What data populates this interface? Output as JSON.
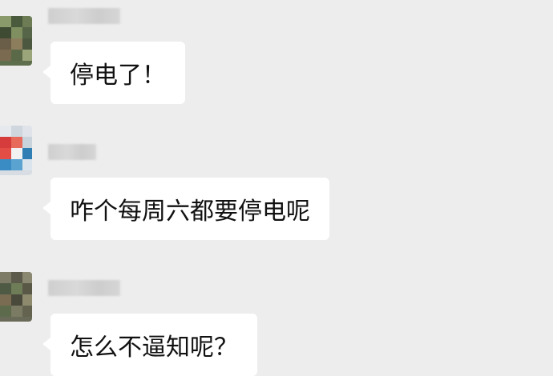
{
  "chat": {
    "messages": [
      {
        "sender_name": "",
        "text": "停电了！"
      },
      {
        "sender_name": "",
        "text": "咋个每周六都要停电呢"
      },
      {
        "sender_name": "",
        "text": "怎么不逼知呢？"
      }
    ]
  },
  "colors": {
    "background": "#ededed",
    "bubble": "#ffffff",
    "text": "#111111"
  }
}
